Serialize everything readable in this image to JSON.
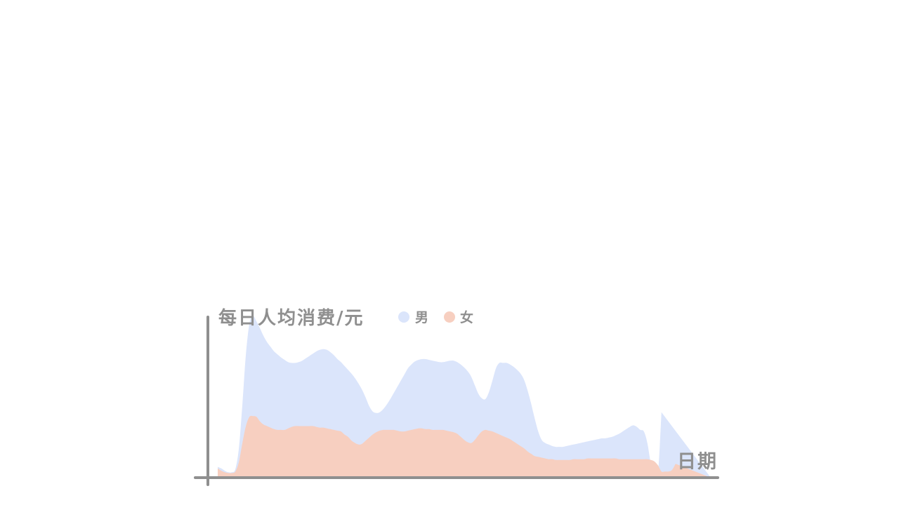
{
  "chart_data": {
    "type": "area",
    "ylabel": "每日人均消费/元",
    "xlabel": "日期",
    "legend_position": "top",
    "grid": false,
    "ylim": [
      0,
      215
    ],
    "x": [
      0,
      1,
      2,
      3,
      4,
      5,
      6,
      7,
      8,
      9,
      10,
      11,
      12,
      13,
      14,
      15,
      16,
      17,
      18,
      19,
      20,
      21,
      22,
      23,
      24,
      25,
      26,
      27,
      28,
      29,
      30,
      31,
      32,
      33,
      34,
      35,
      36,
      37,
      38,
      39,
      40,
      41,
      42,
      43,
      44,
      45,
      46,
      47,
      48,
      49,
      50,
      51,
      52,
      53,
      54,
      55,
      56,
      57,
      58,
      59,
      60,
      61,
      62,
      63,
      64,
      65,
      66,
      67,
      68,
      69,
      70,
      71,
      72,
      73,
      74,
      75,
      76,
      77,
      78,
      79,
      80,
      81,
      82,
      83,
      84,
      85,
      86,
      87,
      88,
      89,
      90,
      91,
      92,
      93,
      94,
      95,
      96,
      97,
      98,
      99,
      100,
      101,
      102,
      103,
      104,
      105,
      106,
      107,
      108,
      109,
      110,
      111,
      112,
      113,
      114,
      115,
      116,
      117,
      118,
      119,
      120,
      121,
      122,
      123,
      124,
      125,
      126,
      127,
      128,
      129,
      130,
      131,
      132,
      133,
      134,
      135,
      136,
      137,
      138,
      139,
      140
    ],
    "series": [
      {
        "name": "男",
        "color": "#dbe5fb",
        "values": [
          14,
          12,
          9,
          7,
          7,
          11,
          38,
          95,
          160,
          200,
          210,
          203,
          194,
          184,
          176,
          170,
          164,
          160,
          156,
          153,
          150,
          149,
          149,
          150,
          152,
          155,
          158,
          161,
          164,
          166,
          167,
          166,
          163,
          159,
          154,
          150,
          145,
          140,
          135,
          129,
          122,
          114,
          104,
          93,
          86,
          84,
          85,
          89,
          95,
          102,
          110,
          118,
          126,
          134,
          142,
          147,
          151,
          153,
          154,
          154,
          153,
          152,
          151,
          150,
          150,
          151,
          152,
          152,
          150,
          147,
          143,
          138,
          131,
          120,
          109,
          103,
          102,
          111,
          126,
          142,
          149,
          149,
          149,
          147,
          144,
          140,
          135,
          127,
          113,
          96,
          77,
          60,
          49,
          45,
          43,
          41,
          40,
          40,
          40,
          41,
          42,
          43,
          44,
          45,
          46,
          47,
          48,
          49,
          50,
          51,
          51,
          52,
          53,
          55,
          57,
          60,
          63,
          66,
          68,
          66,
          62,
          60,
          45,
          18,
          8,
          6,
          85
        ]
      },
      {
        "name": "女",
        "color": "#f7cfc0",
        "values": [
          12,
          9,
          7,
          6,
          6,
          8,
          20,
          45,
          67,
          79,
          80,
          79,
          73,
          69,
          67,
          65,
          63,
          62,
          62,
          62,
          64,
          66,
          67,
          67,
          67,
          67,
          67,
          67,
          66,
          65,
          65,
          64,
          63,
          62,
          61,
          60,
          56,
          53,
          48,
          45,
          43,
          44,
          48,
          52,
          56,
          59,
          61,
          62,
          62,
          62,
          62,
          61,
          60,
          60,
          61,
          62,
          63,
          64,
          64,
          63,
          63,
          62,
          62,
          62,
          62,
          61,
          60,
          59,
          57,
          53,
          49,
          46,
          45,
          49,
          55,
          60,
          62,
          61,
          60,
          58,
          56,
          54,
          52,
          50,
          47,
          44,
          41,
          38,
          34,
          31,
          28,
          27,
          26,
          25,
          24,
          24,
          23,
          23,
          23,
          23,
          23,
          24,
          24,
          24,
          24,
          25,
          25,
          25,
          25,
          25,
          25,
          25,
          25,
          25,
          24,
          24,
          24,
          24,
          24,
          24,
          24,
          24,
          24,
          23,
          21,
          16,
          8,
          8,
          8,
          10,
          18
        ]
      }
    ]
  }
}
